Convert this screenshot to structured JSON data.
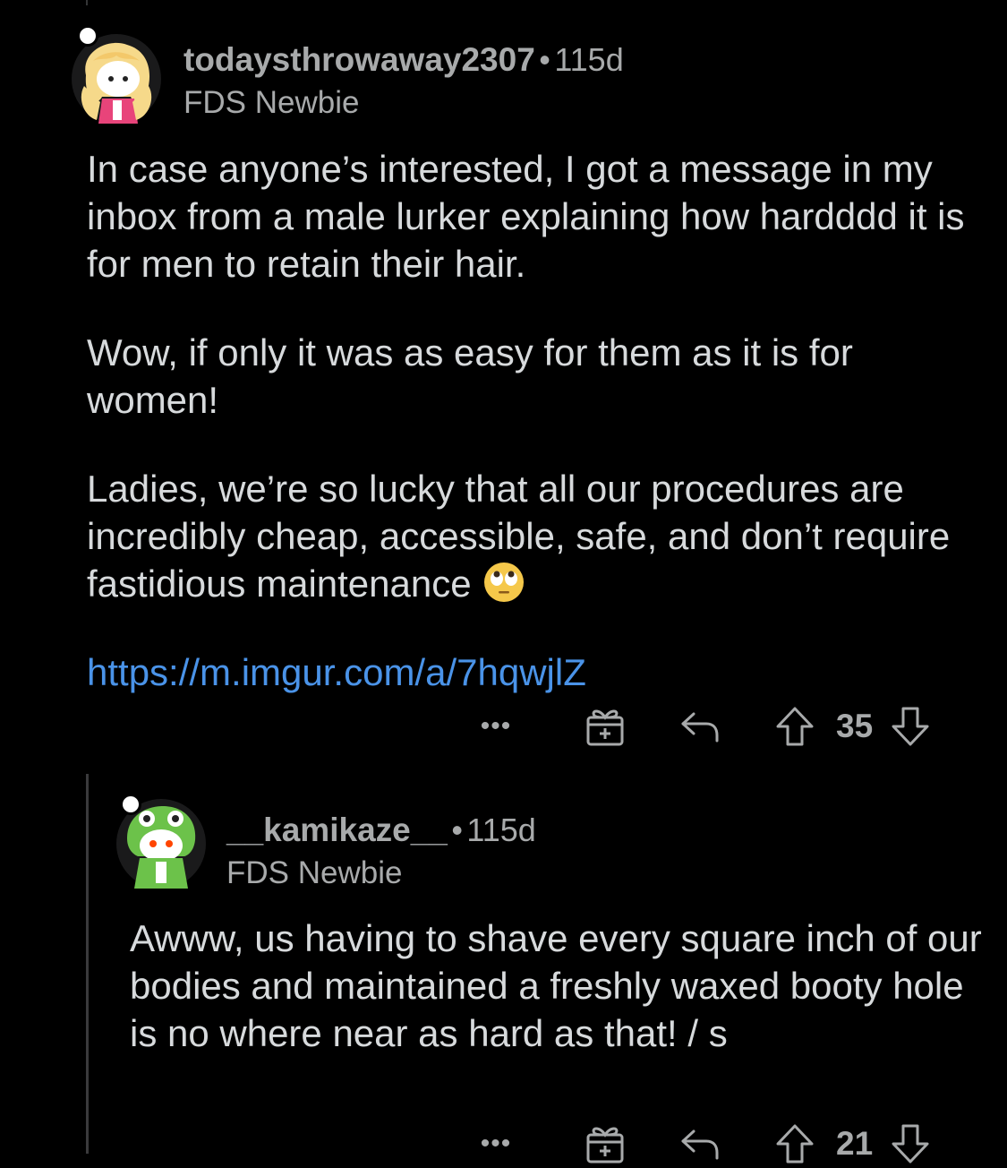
{
  "comments": [
    {
      "username": "todaysthrowaway2307",
      "separator": "•",
      "age": "115d",
      "flair": "FDS Newbie",
      "avatar_icon": "avatar-blonde-girl-icon",
      "paragraphs": [
        "In case anyone’s interested, I got a message in my inbox from a male lurker explaining how hardddd it is for men to retain their hair.",
        "Wow, if only it was as easy for them as it is for women!",
        "Ladies, we’re so lucky that all our procedures are incredibly cheap, accessible, safe, and don’t require fastidious maintenance"
      ],
      "emoji": "face-with-rolling-eyes-icon",
      "link": "https://m.imgur.com/a/7hqwjlZ",
      "actions": {
        "more": "•••",
        "score": "35"
      }
    },
    {
      "username": "__kamikaze__",
      "separator": "•",
      "age": "115d",
      "flair": "FDS Newbie",
      "avatar_icon": "avatar-frog-hood-icon",
      "paragraphs": [
        "Awww, us having to shave every square inch of our bodies and maintained a freshly waxed booty hole is no where near as hard as that! / s"
      ],
      "actions": {
        "more": "•••",
        "score": "21"
      }
    }
  ],
  "colors": {
    "background": "#000000",
    "text": "#d7dadc",
    "meta": "#a8aaab",
    "link": "#4a93e8"
  }
}
